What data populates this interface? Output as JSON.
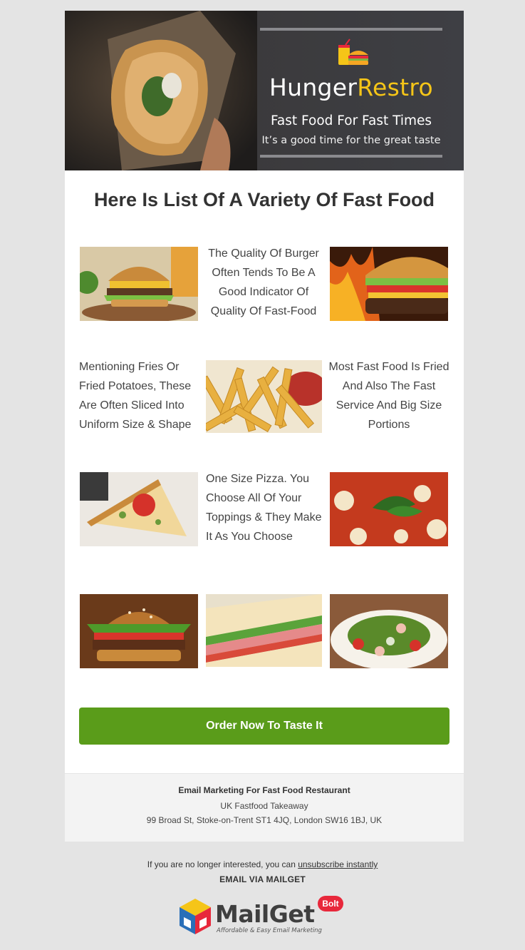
{
  "hero": {
    "brand_first": "Hunger",
    "brand_second": "Restro",
    "tagline": "Fast Food For Fast Times",
    "subtagline": "It’s a good time for the great taste"
  },
  "heading": "Here Is List Of A Variety Of Fast Food",
  "rows": [
    {
      "text": "The Quality Of Burger Often Tends To Be A Good Indicator Of Quality Of Fast-Food",
      "images": [
        "burger-with-drink",
        "flame-grilled-burger"
      ]
    },
    {
      "text_left": "Mentioning Fries Or Fried Potatoes, These Are Often Sliced Into Uniform Size & Shape",
      "text_right": "Most Fast Food Is Fried And Also The Fast Service And Big Size Portions",
      "images": [
        "french-fries"
      ]
    },
    {
      "text": "One Size Pizza. You Choose All Of Your Toppings & They Make It As You Choose",
      "images": [
        "pizza-slice",
        "pizza-with-basil"
      ]
    },
    {
      "images": [
        "stacked-burger",
        "sandwich",
        "salad-plate"
      ]
    }
  ],
  "cta": {
    "label": "Order Now To Taste It"
  },
  "footer": {
    "title": "Email Marketing For Fast Food Restaurant",
    "company": "UK Fastfood Takeaway",
    "address": "99 Broad St, Stoke-on-Trent ST1 4JQ, London SW16 1BJ, UK"
  },
  "unsubscribe": {
    "prefix": "If you are no longer interested, you can ",
    "link": "unsubscribe instantly"
  },
  "via": "EMAIL VIA MAILGET",
  "mailget": {
    "wordmark": "MailGet",
    "badge": "Bolt",
    "subtitle": "Affordable & Easy Email Marketing"
  },
  "colors": {
    "accent_yellow": "#f5c518",
    "cta_green": "#5a9c1a",
    "page_bg": "#e4e4e4"
  }
}
